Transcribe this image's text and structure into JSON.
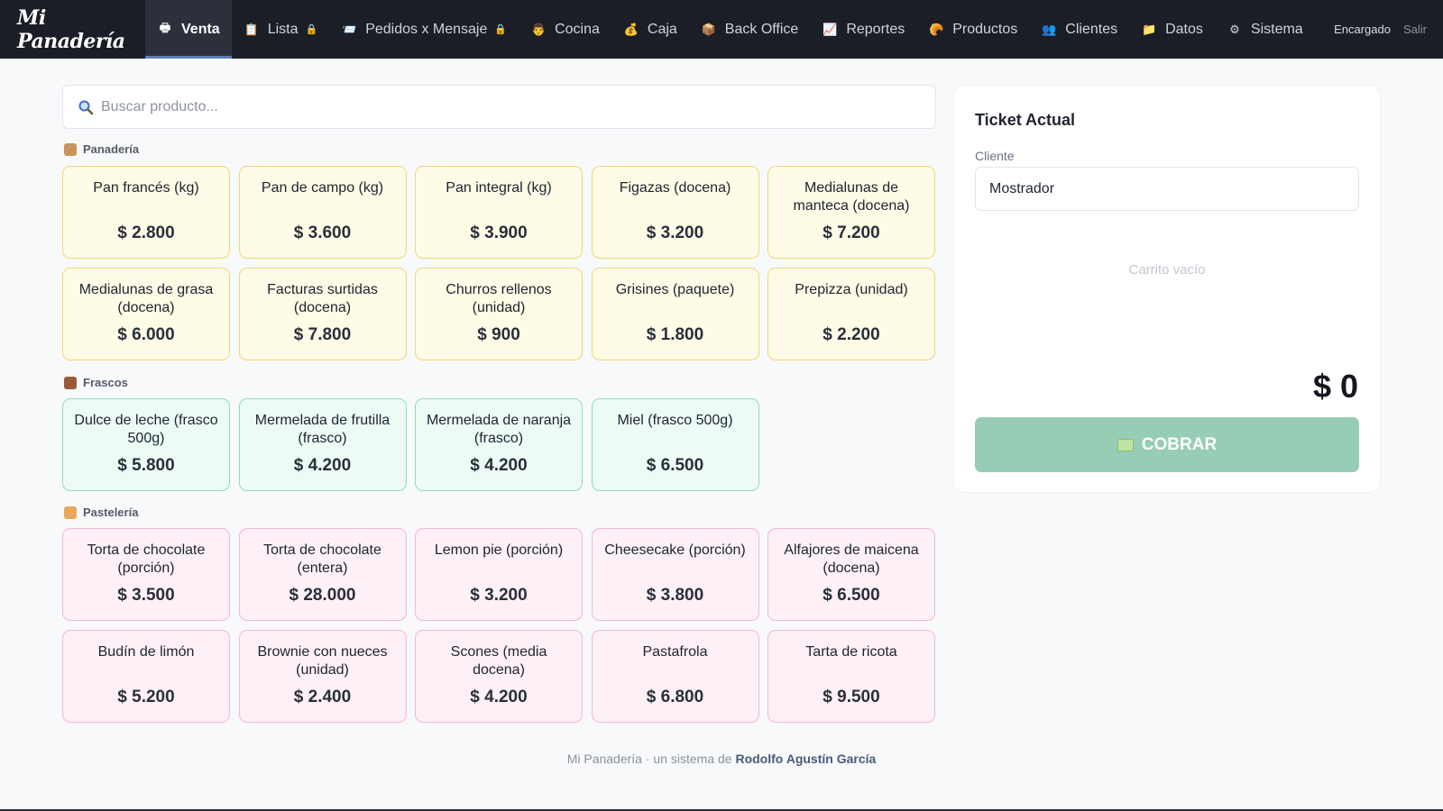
{
  "brand": "Mi Panadería",
  "nav": [
    {
      "label": "Venta",
      "icon": "register-icon",
      "glyph": "🖶",
      "active": true,
      "locked": false
    },
    {
      "label": "Lista",
      "icon": "clipboard-icon",
      "glyph": "📋",
      "locked": true
    },
    {
      "label": "Pedidos x Mensaje",
      "icon": "message-icon",
      "glyph": "📨",
      "locked": true
    },
    {
      "label": "Cocina",
      "icon": "chef-icon",
      "glyph": "👨",
      "locked": false
    },
    {
      "label": "Caja",
      "icon": "money-bag-icon",
      "glyph": "💰",
      "locked": false
    },
    {
      "label": "Back Office",
      "icon": "box-icon",
      "glyph": "📦",
      "locked": false
    },
    {
      "label": "Reportes",
      "icon": "chart-icon",
      "glyph": "📈",
      "locked": false
    },
    {
      "label": "Productos",
      "icon": "croissant-icon",
      "glyph": "🥐",
      "locked": false
    },
    {
      "label": "Clientes",
      "icon": "users-icon",
      "glyph": "👥",
      "locked": false
    },
    {
      "label": "Datos",
      "icon": "folder-icon",
      "glyph": "📁",
      "locked": false
    },
    {
      "label": "Sistema",
      "icon": "gear-icon",
      "glyph": "⚙",
      "locked": false
    }
  ],
  "user": "Encargado",
  "logout": "Salir",
  "search": {
    "placeholder": "Buscar producto..."
  },
  "categories": [
    {
      "title": "Panadería",
      "icon": "box-icon",
      "color": "yellow",
      "products": [
        {
          "name": "Pan francés (kg)",
          "price": "$ 2.800"
        },
        {
          "name": "Pan de campo (kg)",
          "price": "$ 3.600"
        },
        {
          "name": "Pan integral (kg)",
          "price": "$ 3.900"
        },
        {
          "name": "Figazas (docena)",
          "price": "$ 3.200"
        },
        {
          "name": "Medialunas de manteca (docena)",
          "price": "$ 7.200"
        },
        {
          "name": "Medialunas de grasa (docena)",
          "price": "$ 6.000"
        },
        {
          "name": "Facturas surtidas (docena)",
          "price": "$ 7.800"
        },
        {
          "name": "Churros rellenos (unidad)",
          "price": "$ 900"
        },
        {
          "name": "Grisines (paquete)",
          "price": "$ 1.800"
        },
        {
          "name": "Prepizza (unidad)",
          "price": "$ 2.200"
        }
      ]
    },
    {
      "title": "Frascos",
      "icon": "jar-icon",
      "color": "green",
      "products": [
        {
          "name": "Dulce de leche (frasco 500g)",
          "price": "$ 5.800"
        },
        {
          "name": "Mermelada de frutilla (frasco)",
          "price": "$ 4.200"
        },
        {
          "name": "Mermelada de naranja (frasco)",
          "price": "$ 4.200"
        },
        {
          "name": "Miel (frasco 500g)",
          "price": "$ 6.500"
        }
      ]
    },
    {
      "title": "Pastelería",
      "icon": "cake-icon",
      "color": "pink",
      "products": [
        {
          "name": "Torta de chocolate (porción)",
          "price": "$ 3.500"
        },
        {
          "name": "Torta de chocolate (entera)",
          "price": "$ 28.000"
        },
        {
          "name": "Lemon pie (porción)",
          "price": "$ 3.200"
        },
        {
          "name": "Cheesecake (porción)",
          "price": "$ 3.800"
        },
        {
          "name": "Alfajores de maicena (docena)",
          "price": "$ 6.500"
        },
        {
          "name": "Budín de limón",
          "price": "$ 5.200"
        },
        {
          "name": "Brownie con nueces (unidad)",
          "price": "$ 2.400"
        },
        {
          "name": "Scones (media docena)",
          "price": "$ 4.200"
        },
        {
          "name": "Pastafrola",
          "price": "$ 6.800"
        },
        {
          "name": "Tarta de ricota",
          "price": "$ 9.500"
        }
      ]
    }
  ],
  "ticket": {
    "title": "Ticket Actual",
    "client_label": "Cliente",
    "client_value": "Mostrador",
    "empty_text": "Carrito vacío",
    "total": "$ 0",
    "pay_label": "COBRAR"
  },
  "footer": {
    "prefix": "Mi Panadería · un sistema de",
    "author": "Rodolfo Agustín García"
  },
  "colors": {
    "topbar": "#1b1e26",
    "pay_button": "#97cdb4",
    "yellow_card": "#fefbe6",
    "green_card": "#edfbf5",
    "pink_card": "#fdf0f6"
  }
}
